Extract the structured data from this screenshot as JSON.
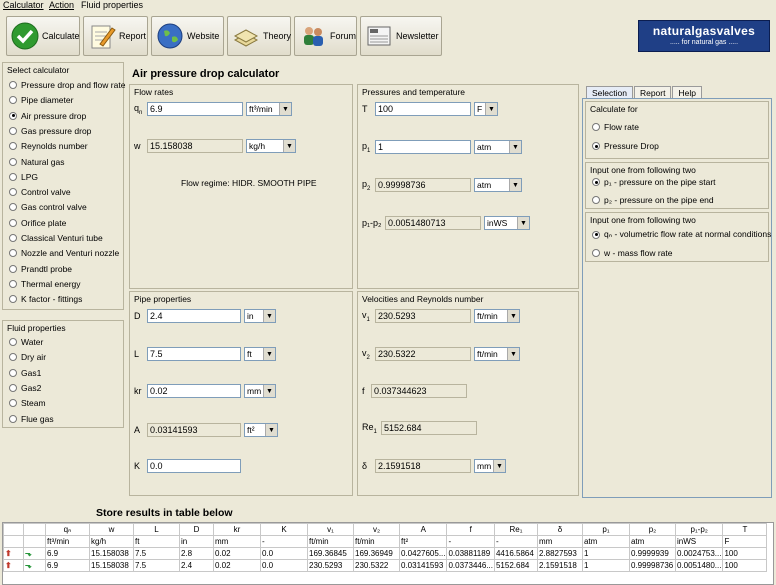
{
  "menu": [
    "Calculator",
    "Action",
    "Fluid properties"
  ],
  "toolbar": {
    "calculate": "Calculate",
    "report": "Report",
    "website": "Website",
    "theory": "Theory",
    "forum": "Forum",
    "newsletter": "Newsletter"
  },
  "logo": {
    "line1": "naturalgasvalves",
    "line2": "..... for natural gas ....."
  },
  "sidebar": {
    "select_title": "Select calculator",
    "calculators": [
      "Pressure drop and flow rate",
      "Pipe diameter",
      "Air pressure drop",
      "Gas pressure drop",
      "Reynolds number",
      "Natural gas",
      "LPG",
      "Control valve",
      "Gas control valve",
      "Orifice plate",
      "Classical Venturi tube",
      "Nozzle and Venturi nozzle",
      "Prandtl probe",
      "Thermal energy",
      "K factor - fittings"
    ],
    "selected_calculator": 2,
    "fluid_title": "Fluid properties",
    "fluids": [
      "Water",
      "Dry air",
      "Gas1",
      "Gas2",
      "Steam",
      "Flue gas"
    ]
  },
  "main": {
    "title": "Air pressure drop calculator",
    "flow_rates": {
      "title": "Flow rates",
      "qn_label": "q",
      "qn_sub": "n",
      "qn_value": "6.9",
      "qn_unit": "ft³/min",
      "w_label": "w",
      "w_value": "15.158038",
      "w_unit": "kg/h",
      "regime": "Flow regime: HIDR. SMOOTH PIPE"
    },
    "pressures": {
      "title": "Pressures and temperature",
      "t_label": "T",
      "t_value": "100",
      "t_unit": "F",
      "p1_label": "p",
      "p1_sub": "1",
      "p1_value": "1",
      "p1_unit": "atm",
      "p2_label": "p",
      "p2_sub": "2",
      "p2_value": "0.99998736",
      "p2_unit": "atm",
      "dp_label": "p₁-p₂",
      "dp_value": "0.0051480713",
      "dp_unit": "inWS"
    },
    "pipe": {
      "title": "Pipe properties",
      "d_label": "D",
      "d_value": "2.4",
      "d_unit": "in",
      "l_label": "L",
      "l_value": "7.5",
      "l_unit": "ft",
      "kr_label": "kr",
      "kr_value": "0.02",
      "kr_unit": "mm",
      "a_label": "A",
      "a_value": "0.03141593",
      "a_unit": "ft²",
      "k_label": "K",
      "k_value": "0.0"
    },
    "velocities": {
      "title": "Velocities and Reynolds number",
      "v1_label": "v",
      "v1_sub": "1",
      "v1_value": "230.5293",
      "v1_unit": "ft/min",
      "v2_label": "v",
      "v2_sub": "2",
      "v2_value": "230.5322",
      "v2_unit": "ft/min",
      "f_label": "f",
      "f_value": "0.037344623",
      "re_label": "Re",
      "re_sub": "1",
      "re_value": "5152.684",
      "delta_label": "δ",
      "delta_value": "2.1591518",
      "delta_unit": "mm"
    }
  },
  "right_panel": {
    "tabs": [
      "Selection",
      "Report",
      "Help"
    ],
    "calc_for_title": "Calculate for",
    "calc_for": [
      "Flow rate",
      "Pressure Drop"
    ],
    "input1_title": "Input one from following two",
    "input1": [
      "p₁ - pressure on the pipe start",
      "p₂ - pressure on the pipe end"
    ],
    "input2_title": "Input one from following two",
    "input2": [
      "qₙ - volumetric flow rate at normal conditions",
      "w - mass flow rate"
    ]
  },
  "store": {
    "title": "Store results in table below",
    "headers": [
      "qₙ",
      "w",
      "L",
      "D",
      "kr",
      "K",
      "v₁",
      "v₂",
      "A",
      "f",
      "Re₁",
      "δ",
      "p₁",
      "p₂",
      "p₁-p₂",
      "T"
    ],
    "units": [
      "ft³/min",
      "kg/h",
      "ft",
      "in",
      "mm",
      "-",
      "ft/min",
      "ft/min",
      "ft²",
      "-",
      "-",
      "mm",
      "atm",
      "atm",
      "inWS",
      "F"
    ],
    "rows": [
      [
        "6.9",
        "15.158038",
        "7.5",
        "2.8",
        "0.02",
        "0.0",
        "169.36845",
        "169.36949",
        "0.0427605...",
        "0.03881189",
        "4416.5864",
        "2.8827593",
        "1",
        "0.9999939",
        "0.0024753...",
        "100"
      ],
      [
        "6.9",
        "15.158038",
        "7.5",
        "2.4",
        "0.02",
        "0.0",
        "230.5293",
        "230.5322",
        "0.03141593",
        "0.0373446...",
        "5152.684",
        "2.1591518",
        "1",
        "0.99998736",
        "0.0051480...",
        "100"
      ]
    ]
  }
}
